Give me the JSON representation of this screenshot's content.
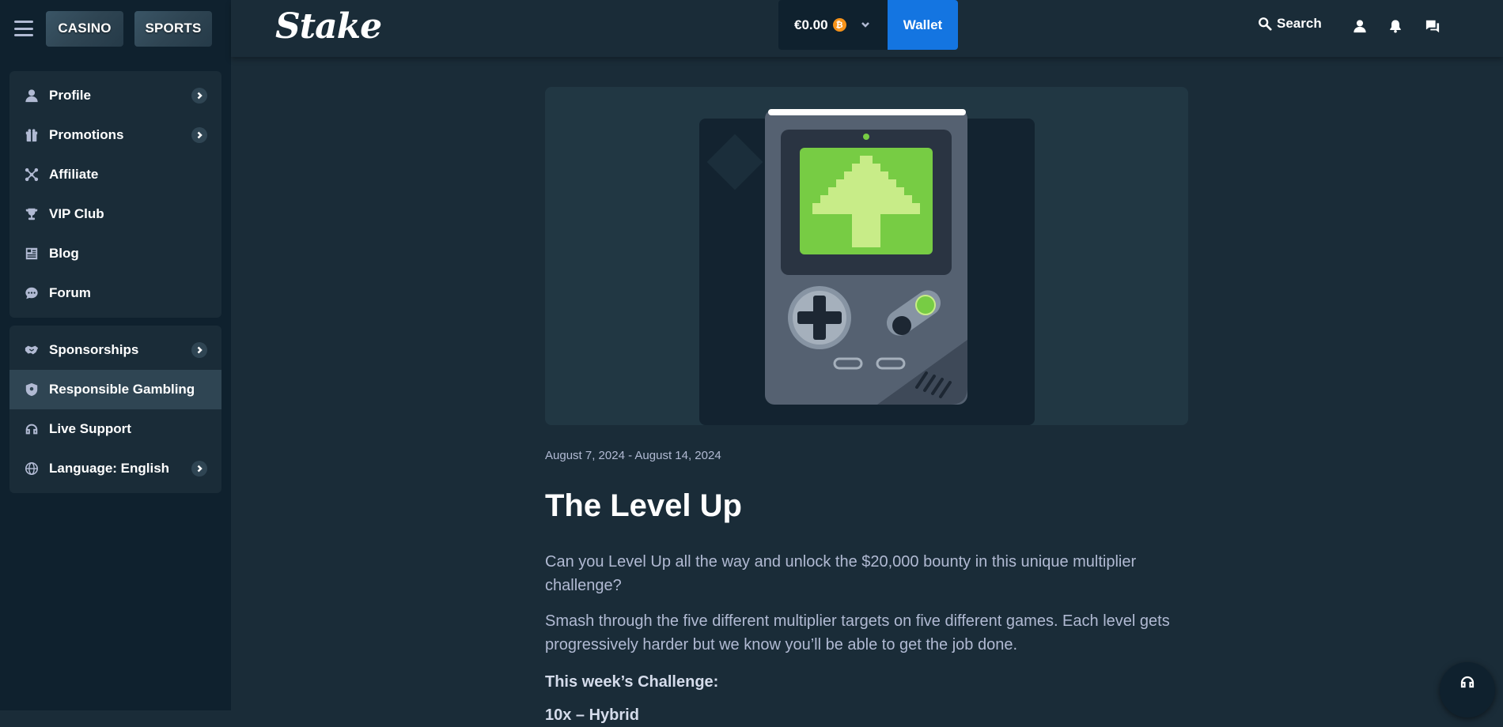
{
  "header": {
    "modes": {
      "casino": "CASINO",
      "sports": "SPORTS"
    },
    "logo": "Stake",
    "balance": "€0.00",
    "currency_icon": "bitcoin-icon",
    "wallet_label": "Wallet",
    "search_label": "Search"
  },
  "sidebar": {
    "group1": [
      {
        "label": "Profile",
        "icon": "user-icon",
        "chevron": true
      },
      {
        "label": "Promotions",
        "icon": "gift-icon",
        "chevron": true
      },
      {
        "label": "Affiliate",
        "icon": "affiliate-icon",
        "chevron": false
      },
      {
        "label": "VIP Club",
        "icon": "trophy-icon",
        "chevron": false
      },
      {
        "label": "Blog",
        "icon": "blog-icon",
        "chevron": false
      },
      {
        "label": "Forum",
        "icon": "forum-icon",
        "chevron": false
      }
    ],
    "group2": [
      {
        "label": "Sponsorships",
        "icon": "handshake-icon",
        "chevron": true
      },
      {
        "label": "Responsible Gambling",
        "icon": "shield-icon",
        "chevron": false,
        "active": true
      },
      {
        "label": "Live Support",
        "icon": "headset-icon",
        "chevron": false
      },
      {
        "label": "Language: English",
        "icon": "globe-icon",
        "chevron": true
      }
    ]
  },
  "promo": {
    "date_range": "August 7, 2024 - August 14, 2024",
    "title": "The Level Up",
    "paragraphs": [
      "Can you Level Up all the way and unlock the $20,000 bounty in this unique multiplier challenge?",
      "Smash through the five different multiplier targets on five different games. Each level gets progressively harder but we know you’ll be able to get the job done.",
      "This week’s Challenge:",
      "10x – Hybrid"
    ]
  },
  "colors": {
    "bg": "#1a2c38",
    "sidebar": "#0f212e",
    "accent_blue": "#1475e1",
    "text_muted": "#b1bad3",
    "screen_green": "#77cc44"
  }
}
